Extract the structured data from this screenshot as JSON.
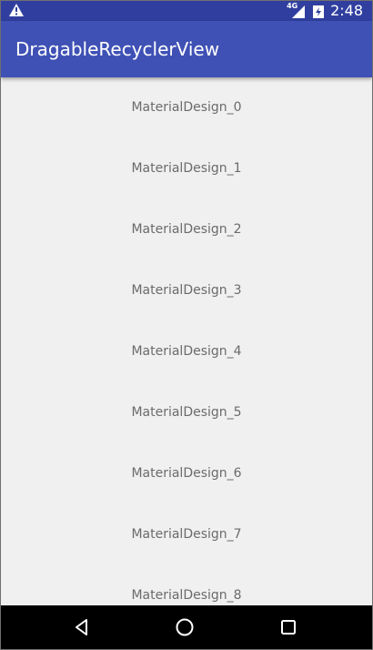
{
  "status_bar": {
    "network": "4G",
    "time": "2:48"
  },
  "app_bar": {
    "title": "DragableRecyclerView"
  },
  "list": {
    "items": [
      "MaterialDesign_0",
      "MaterialDesign_1",
      "MaterialDesign_2",
      "MaterialDesign_3",
      "MaterialDesign_4",
      "MaterialDesign_5",
      "MaterialDesign_6",
      "MaterialDesign_7",
      "MaterialDesign_8"
    ]
  },
  "nav_bar": {
    "buttons": [
      "back-icon",
      "home-icon",
      "recents-icon"
    ]
  },
  "colors": {
    "primary": "#3F51B5",
    "primary_dark": "#303F9F",
    "background": "#f0f0f0",
    "item_text": "#6b6b6b"
  }
}
